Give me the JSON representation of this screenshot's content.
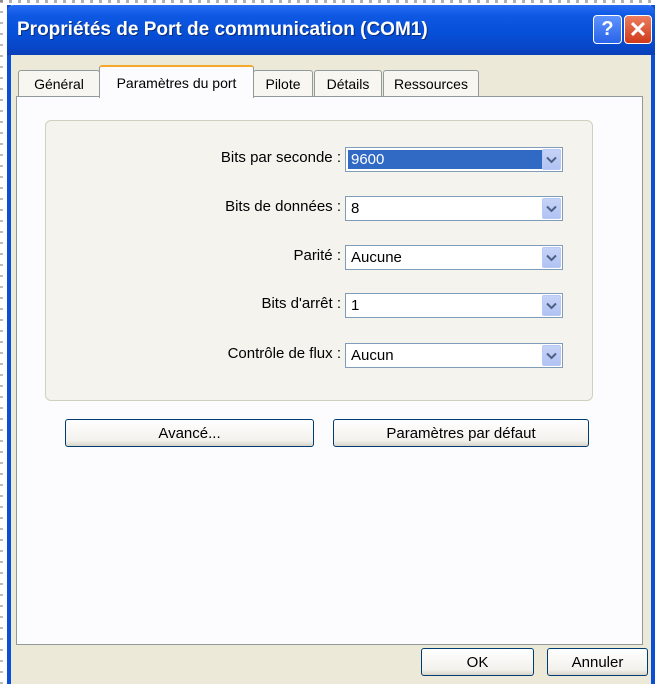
{
  "window": {
    "title": "Propriétés de Port de communication (COM1)"
  },
  "titlebar": {
    "help_glyph": "?",
    "close_glyph": "✕"
  },
  "tabs": [
    {
      "label": "Général"
    },
    {
      "label": "Paramètres du port"
    },
    {
      "label": "Pilote"
    },
    {
      "label": "Détails"
    },
    {
      "label": "Ressources"
    }
  ],
  "settings": {
    "bits_per_second": {
      "label": "Bits par seconde :",
      "value": "9600"
    },
    "data_bits": {
      "label": "Bits de données :",
      "value": "8"
    },
    "parity": {
      "label": "Parité :",
      "value": "Aucune"
    },
    "stop_bits": {
      "label": "Bits d'arrêt :",
      "value": "1"
    },
    "flow_control": {
      "label": "Contrôle de flux :",
      "value": "Aucun"
    }
  },
  "buttons": {
    "advanced": "Avancé...",
    "defaults": "Paramètres par défaut",
    "ok": "OK",
    "cancel": "Annuler"
  },
  "colors": {
    "title_blue": "#0650d8",
    "selection": "#316ac5",
    "tab_highlight": "#f4a92a",
    "window_bg": "#ece9d8"
  },
  "icons": {
    "dropdown": "chevron-down-icon",
    "help": "help-icon",
    "close": "close-icon"
  }
}
